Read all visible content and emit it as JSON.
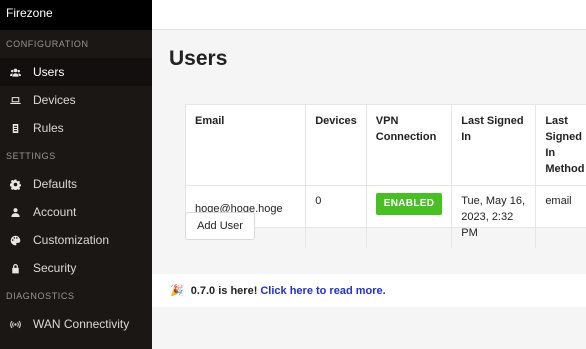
{
  "app": {
    "brand": "Firezone"
  },
  "sidebar": {
    "sections": [
      {
        "label": "CONFIGURATION",
        "items": [
          {
            "label": "Users",
            "icon": "users-icon",
            "active": true
          },
          {
            "label": "Devices",
            "icon": "laptop-icon"
          },
          {
            "label": "Rules",
            "icon": "rules-icon"
          }
        ]
      },
      {
        "label": "SETTINGS",
        "items": [
          {
            "label": "Defaults",
            "icon": "gear-icon"
          },
          {
            "label": "Account",
            "icon": "user-icon"
          },
          {
            "label": "Customization",
            "icon": "palette-icon"
          },
          {
            "label": "Security",
            "icon": "lock-icon"
          }
        ]
      },
      {
        "label": "DIAGNOSTICS",
        "items": [
          {
            "label": "WAN Connectivity",
            "icon": "signal-icon"
          }
        ]
      }
    ]
  },
  "main": {
    "title": "Users",
    "table": {
      "headers": [
        "Email",
        "Devices",
        "VPN Connection",
        "Last Signed In",
        "Last Signed In Method"
      ],
      "rows": [
        {
          "email": "hoge@hoge.hoge",
          "devices": "0",
          "vpn": "ENABLED",
          "last_signed_in": "Tue, May 16, 2023, 2:32 PM",
          "method": "email"
        }
      ]
    },
    "add_user_label": "Add User",
    "notice": {
      "text": "0.7.0 is here!",
      "link": "Click here to read more."
    }
  },
  "colors": {
    "sidebar_bg": "#1b1715",
    "badge_green": "#48c023",
    "link_blue": "#2132c4"
  }
}
